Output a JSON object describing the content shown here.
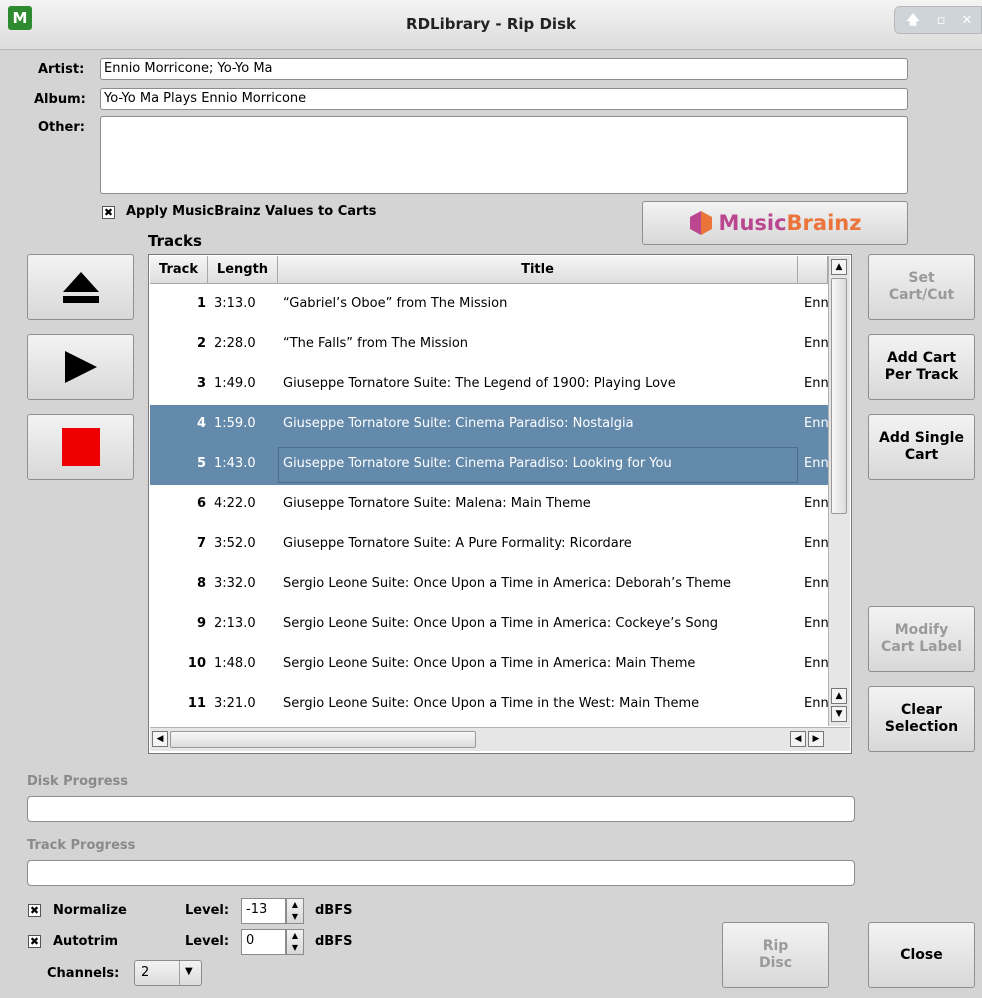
{
  "window": {
    "title": "RDLibrary - Rip Disk",
    "controls": [
      "🡅",
      "▫",
      "✕"
    ]
  },
  "form": {
    "artist_label": "Artist:",
    "artist_value": "Ennio Morricone; Yo-Yo Ma",
    "album_label": "Album:",
    "album_value": "Yo-Yo Ma Plays Ennio Morricone",
    "other_label": "Other:",
    "other_value": "",
    "apply_mb_label": "Apply MusicBrainz Values to Carts",
    "apply_mb_checked": "✖"
  },
  "musicbrainz": {
    "text_a": "Music",
    "text_b": "Brainz",
    "color_a": "#ba478f",
    "color_b": "#eb743b"
  },
  "tracks_label": "Tracks",
  "table": {
    "headers": {
      "track": "Track",
      "length": "Length",
      "title": "Title"
    },
    "rows": [
      {
        "track": "1",
        "length": "3:13.0",
        "title": "“Gabriel’s Oboe” from The Mission",
        "artist": "Enn"
      },
      {
        "track": "2",
        "length": "2:28.0",
        "title": "“The Falls” from The Mission",
        "artist": "Enn"
      },
      {
        "track": "3",
        "length": "1:49.0",
        "title": "Giuseppe Tornatore Suite: The Legend of 1900: Playing Love",
        "artist": "Enn"
      },
      {
        "track": "4",
        "length": "1:59.0",
        "title": "Giuseppe Tornatore Suite: Cinema Paradiso: Nostalgia",
        "artist": "Enn"
      },
      {
        "track": "5",
        "length": "1:43.0",
        "title": "Giuseppe Tornatore Suite: Cinema Paradiso: Looking for You",
        "artist": "Enn"
      },
      {
        "track": "6",
        "length": "4:22.0",
        "title": "Giuseppe Tornatore Suite: Malena: Main Theme",
        "artist": "Enn"
      },
      {
        "track": "7",
        "length": "3:52.0",
        "title": "Giuseppe Tornatore Suite: A Pure Formality: Ricordare",
        "artist": "Enn"
      },
      {
        "track": "8",
        "length": "3:32.0",
        "title": "Sergio Leone Suite: Once Upon a Time in America: Deborah’s Theme",
        "artist": "Enn"
      },
      {
        "track": "9",
        "length": "2:13.0",
        "title": "Sergio Leone Suite: Once Upon a Time in America: Cockeye’s Song",
        "artist": "Enn"
      },
      {
        "track": "10",
        "length": "1:48.0",
        "title": "Sergio Leone Suite: Once Upon a Time in America: Main Theme",
        "artist": "Enn"
      },
      {
        "track": "11",
        "length": "3:21.0",
        "title": "Sergio Leone Suite: Once Upon a Time in the West: Main Theme",
        "artist": "Enn"
      }
    ]
  },
  "side_buttons": {
    "set_cart_cut": "Set\nCart/Cut",
    "add_cart_per_track": "Add Cart\nPer Track",
    "add_single_cart": "Add Single\nCart",
    "modify_cart_label": "Modify\nCart Label",
    "clear_selection": "Clear\nSelection"
  },
  "progress": {
    "disk_label": "Disk Progress",
    "disk_value": 0,
    "track_label": "Track Progress",
    "track_value": 0
  },
  "options": {
    "normalize_label": "Normalize",
    "normalize_checked": "✖",
    "normalize_level_label": "Level:",
    "normalize_level": "-13",
    "autotrim_label": "Autotrim",
    "autotrim_checked": "✖",
    "autotrim_level_label": "Level:",
    "autotrim_level": "0",
    "unit": "dBFS",
    "channels_label": "Channels:",
    "channels_value": "2"
  },
  "bottom_buttons": {
    "rip_disc": "Rip\nDisc",
    "close": "Close"
  },
  "colors": {
    "selection": "#6389ab",
    "stop_red": "#ee0000"
  }
}
